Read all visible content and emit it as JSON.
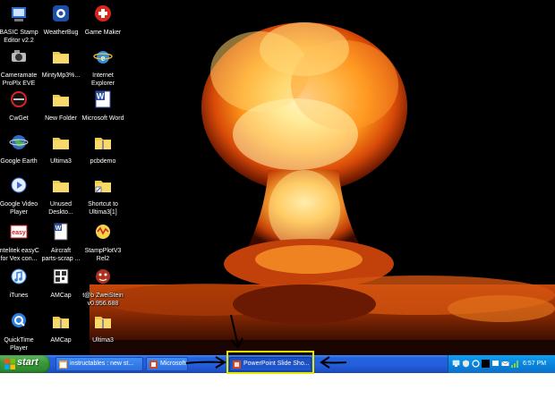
{
  "desktop": {
    "icons": [
      {
        "label": "BASIC Stamp Editor v2.2",
        "line1": "BASIC Stamp",
        "line2": "Editor v2.2",
        "icon": "stamp-editor-icon"
      },
      {
        "label": "WeatherBug",
        "line1": "WeatherBug",
        "line2": "",
        "icon": "weatherbug-icon"
      },
      {
        "label": "Game Maker",
        "line1": "Game Maker",
        "line2": "",
        "icon": "game-maker-icon"
      },
      {
        "label": "Cameramate ProPlx EVE",
        "line1": "Cameramate",
        "line2": "ProPlx EVE",
        "icon": "camera-icon"
      },
      {
        "label": "MintyMp3%...",
        "line1": "MintyMp3%...",
        "line2": "",
        "icon": "folder-icon"
      },
      {
        "label": "Internet Explorer",
        "line1": "Internet",
        "line2": "Explorer",
        "icon": "internet-explorer-icon"
      },
      {
        "label": "CwGet",
        "line1": "CwGet",
        "line2": "",
        "icon": "cwget-icon"
      },
      {
        "label": "New Folder",
        "line1": "New Folder",
        "line2": "",
        "icon": "folder-icon"
      },
      {
        "label": "Microsoft Word",
        "line1": "Microsoft Word",
        "line2": "",
        "icon": "word-icon"
      },
      {
        "label": "Google Earth",
        "line1": "Google Earth",
        "line2": "",
        "icon": "google-earth-icon"
      },
      {
        "label": "Ultima3",
        "line1": "Ultima3",
        "line2": "",
        "icon": "folder-icon"
      },
      {
        "label": "pcbdemo",
        "line1": "pcbdemo",
        "line2": "",
        "icon": "folder-zip-icon"
      },
      {
        "label": "Google Video Player",
        "line1": "Google Video",
        "line2": "Player",
        "icon": "google-video-icon"
      },
      {
        "label": "Unused Deskto...",
        "line1": "Unused",
        "line2": "Deskto...",
        "icon": "folder-icon"
      },
      {
        "label": "Shortcut to Ultima3[1]",
        "line1": "Shortcut to",
        "line2": "Ultima3[1]",
        "icon": "folder-shortcut-icon"
      },
      {
        "label": "intelitek easyC for Vex con...",
        "line1": "intelitek easyC",
        "line2": "for Vex con...",
        "icon": "easyc-icon"
      },
      {
        "label": "Aircraft parts-scrap ...",
        "line1": "Aircraft",
        "line2": "parts-scrap ...",
        "icon": "word-doc-icon"
      },
      {
        "label": "StampPlotV3 Rel2",
        "line1": "StampPlotV3",
        "line2": "Rel2",
        "icon": "stampplot-icon"
      },
      {
        "label": "iTunes",
        "line1": "iTunes",
        "line2": "",
        "icon": "itunes-icon"
      },
      {
        "label": "AMCap",
        "line1": "AMCap",
        "line2": "",
        "icon": "amcap-icon"
      },
      {
        "label": "t@b ZweiStein v0.956.688",
        "line1": "t@b ZweiStein",
        "line2": "v0.956.688",
        "icon": "zweistein-icon"
      },
      {
        "label": "QuickTime Player",
        "line1": "QuickTime",
        "line2": "Player",
        "icon": "quicktime-icon"
      },
      {
        "label": "AMCap",
        "line1": "AMCap",
        "line2": "",
        "icon": "folder-zip-icon"
      },
      {
        "label": "Ultima3",
        "line1": "Ultima3",
        "line2": "",
        "icon": "folder-zip-icon"
      }
    ]
  },
  "taskbar": {
    "start_label": "start",
    "tasks": [
      {
        "label": "instructables : new st...",
        "icon": "browser-icon"
      },
      {
        "label": "Microsoft P...",
        "icon": "powerpoint-icon"
      },
      {
        "label": "PowerPoint Slide Sho...",
        "icon": "powerpoint-slideshow-icon"
      }
    ],
    "clock": "6:57 PM"
  },
  "colors": {
    "taskbar_blue": "#245edb",
    "start_green": "#3c9a3c",
    "tray_blue": "#0a84dd",
    "highlight_yellow": "#e8e800"
  }
}
